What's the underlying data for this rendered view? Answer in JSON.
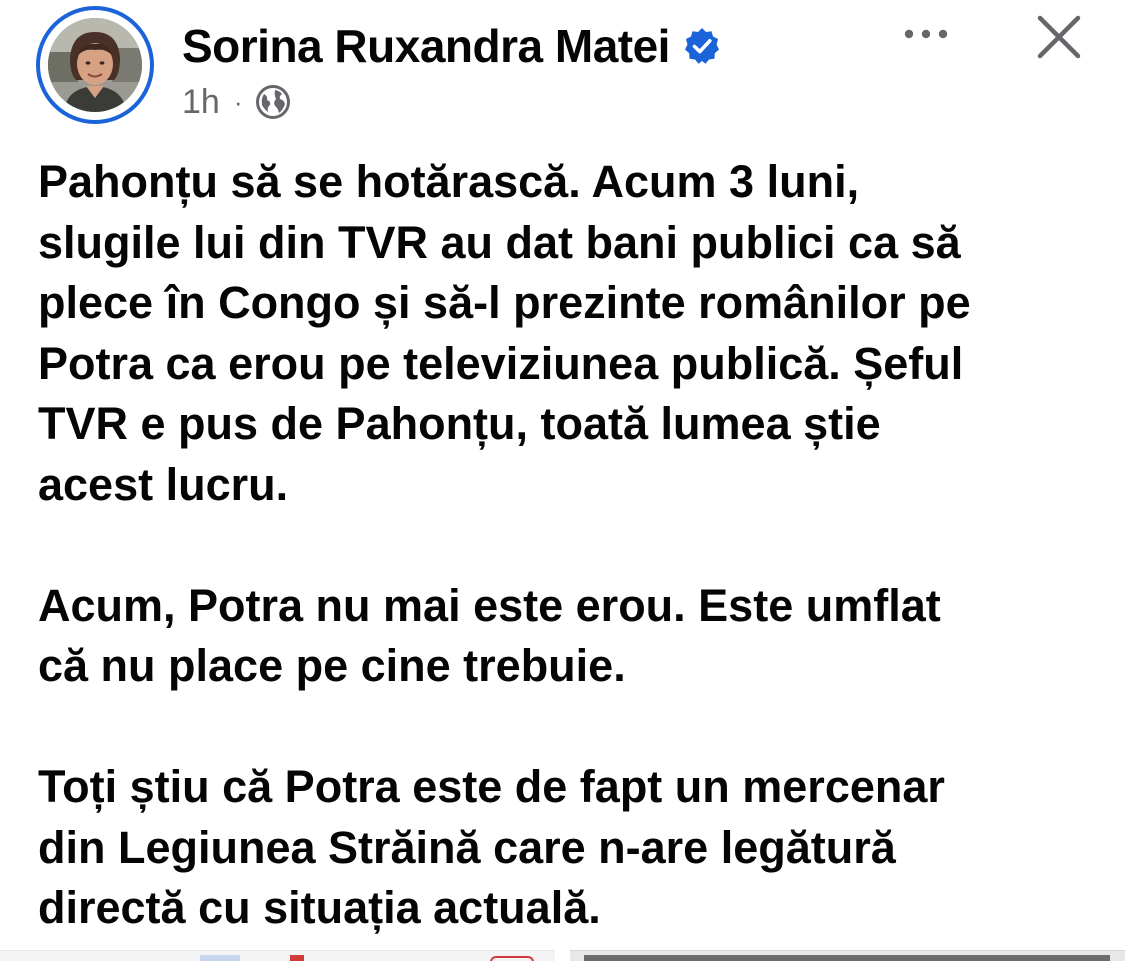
{
  "author": {
    "name": "Sorina Ruxandra Matei",
    "verified": true,
    "avatar_icon": "profile-photo"
  },
  "meta": {
    "time": "1h",
    "separator": "·",
    "audience_icon": "globe-icon"
  },
  "actions": {
    "more_icon": "more-options-icon",
    "close_icon": "close-icon"
  },
  "post": {
    "paragraphs": [
      "Pahonțu să se hotărască. Acum 3 luni,\nslugile lui din TVR au dat bani publici ca să\nplece în Congo și să-l prezinte românilor pe\nPotra ca erou pe televiziunea publică. Șeful\nTVR e pus de Pahonțu, toată lumea știe\nacest lucru.",
      "Acum, Potra nu mai este erou. Este umflat\ncă nu place pe cine trebuie.",
      "Toți știu că Potra este de fapt un mercenar\ndin Legiunea Străină care n-are legătură\ndirectă cu situația actuală."
    ]
  },
  "colors": {
    "accent": "#1b63d8",
    "text": "#050505",
    "secondary_text": "#65676b"
  }
}
